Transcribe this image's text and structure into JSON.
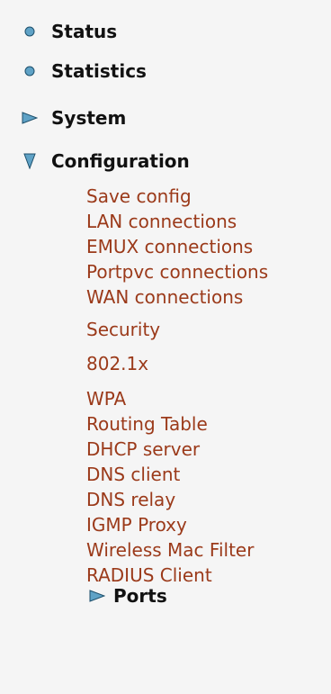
{
  "menu": {
    "status": {
      "label": "Status",
      "icon": "circle-bullet-icon"
    },
    "statistics": {
      "label": "Statistics",
      "icon": "circle-bullet-icon"
    },
    "system": {
      "label": "System",
      "icon": "triangle-right-icon"
    },
    "configuration": {
      "label": "Configuration",
      "icon": "triangle-down-icon",
      "items": [
        "Save config",
        "LAN connections",
        "EMUX connections",
        "Portpvc connections",
        "WAN connections",
        "Security",
        "802.1x",
        "WPA",
        "Routing Table",
        "DHCP server",
        "DNS client",
        "DNS relay",
        "IGMP Proxy",
        "Wireless Mac Filter",
        "RADIUS Client"
      ],
      "ports": {
        "label": "Ports",
        "icon": "triangle-right-icon"
      }
    }
  },
  "colors": {
    "background": "#f5f5f5",
    "icon_fill": "#5fa2c6",
    "icon_stroke": "#1d4f6b",
    "link": "#9b3a1a",
    "heading": "#111111"
  }
}
